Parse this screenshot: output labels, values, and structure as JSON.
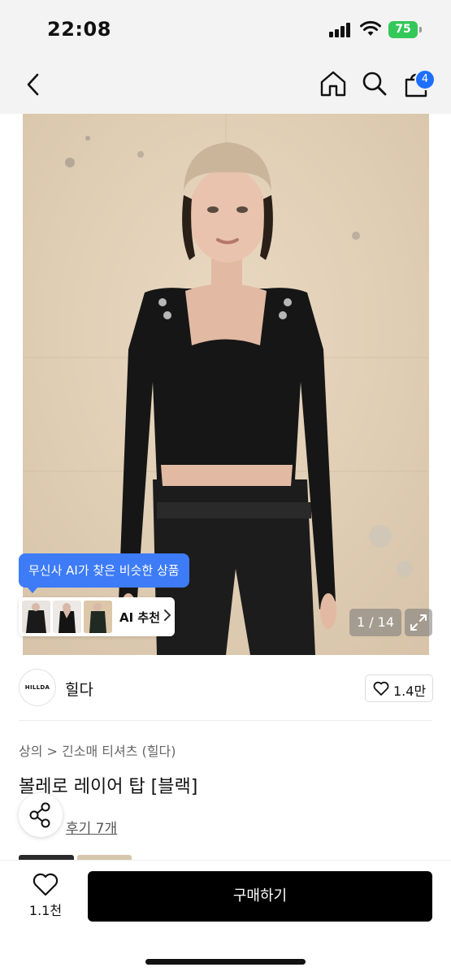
{
  "status_bar": {
    "time": "22:08",
    "battery": "75"
  },
  "nav": {
    "cart_count": "4"
  },
  "icons": [
    "back-icon",
    "home-icon",
    "search-icon",
    "cart-icon",
    "expand-icon",
    "heart-icon",
    "share-icon",
    "chevron-right-icon",
    "signal-icon",
    "wifi-icon",
    "battery-icon"
  ],
  "colors": {
    "accent_blue": "#3d7bf7",
    "badge_blue": "#1e6fff",
    "battery_green": "#34c759",
    "buy_button": "#000000"
  },
  "gallery": {
    "ai_tooltip": "무신사 AI가 찾은 비슷한 상품",
    "ai_recommend_label": "AI 추천",
    "current_image": 1,
    "total_images": 14,
    "counter_text": "1 / 14"
  },
  "brand": {
    "logo_text": "HILLDA",
    "name": "힐다",
    "likes": "1.4만"
  },
  "product": {
    "breadcrumb": "상의 > 긴소매 티셔츠 (힐다)",
    "title": "볼레로 레이어 탑 [블랙]",
    "review_link": "후기 7개"
  },
  "bottom_bar": {
    "wishlist_count": "1.1천",
    "buy_label": "구매하기"
  }
}
